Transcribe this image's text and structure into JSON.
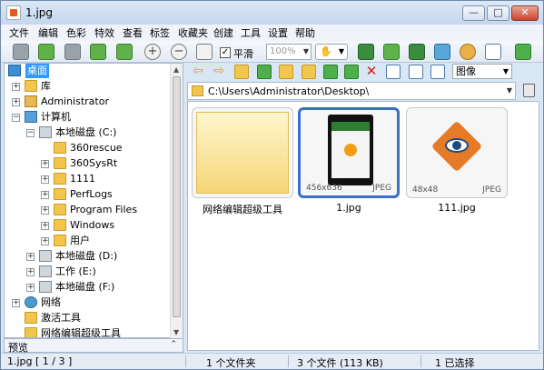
{
  "window": {
    "title": "1.jpg",
    "minimize": "—",
    "maximize": "□",
    "close": "✕"
  },
  "menu": [
    "文件",
    "编辑",
    "色彩",
    "特效",
    "查看",
    "标签",
    "收藏夹",
    "创建",
    "工具",
    "设置",
    "帮助"
  ],
  "toolbar": {
    "smooth_checked": "✓",
    "smooth_label": "平滑",
    "zoom_value": "100%",
    "hand_tool": "✋"
  },
  "tree": {
    "desktop": "桌面",
    "library": "库",
    "administrator": "Administrator",
    "computer": "计算机",
    "drive_c": "本地磁盘 (C:)",
    "folders": [
      "360rescue",
      "360SysRt",
      "1111",
      "PerfLogs",
      "Program Files",
      "Windows",
      "用户"
    ],
    "drive_d": "本地磁盘 (D:)",
    "drive_e": "工作 (E:)",
    "drive_f": "本地磁盘 (F:)",
    "network": "网络",
    "activate_tool": "激活工具",
    "web_tool": "网络编辑超级工具"
  },
  "preview": {
    "label": "预览",
    "toggle": "⌃"
  },
  "navbar": {
    "view_mode": "图像"
  },
  "address": {
    "path": "C:\\Users\\Administrator\\Desktop\\"
  },
  "thumbnails": [
    {
      "caption": "网络编辑超级工具",
      "size": "",
      "type": ""
    },
    {
      "caption": "1.jpg",
      "size": "456x636",
      "type": "JPEG"
    },
    {
      "caption": "111.jpg",
      "size": "48x48",
      "type": "JPEG"
    }
  ],
  "status": {
    "file_index": "1.jpg [ 1 / 3 ]",
    "folders": "1 个文件夹",
    "files": "3 个文件 (113 KB)",
    "selected": "1 已选择"
  }
}
